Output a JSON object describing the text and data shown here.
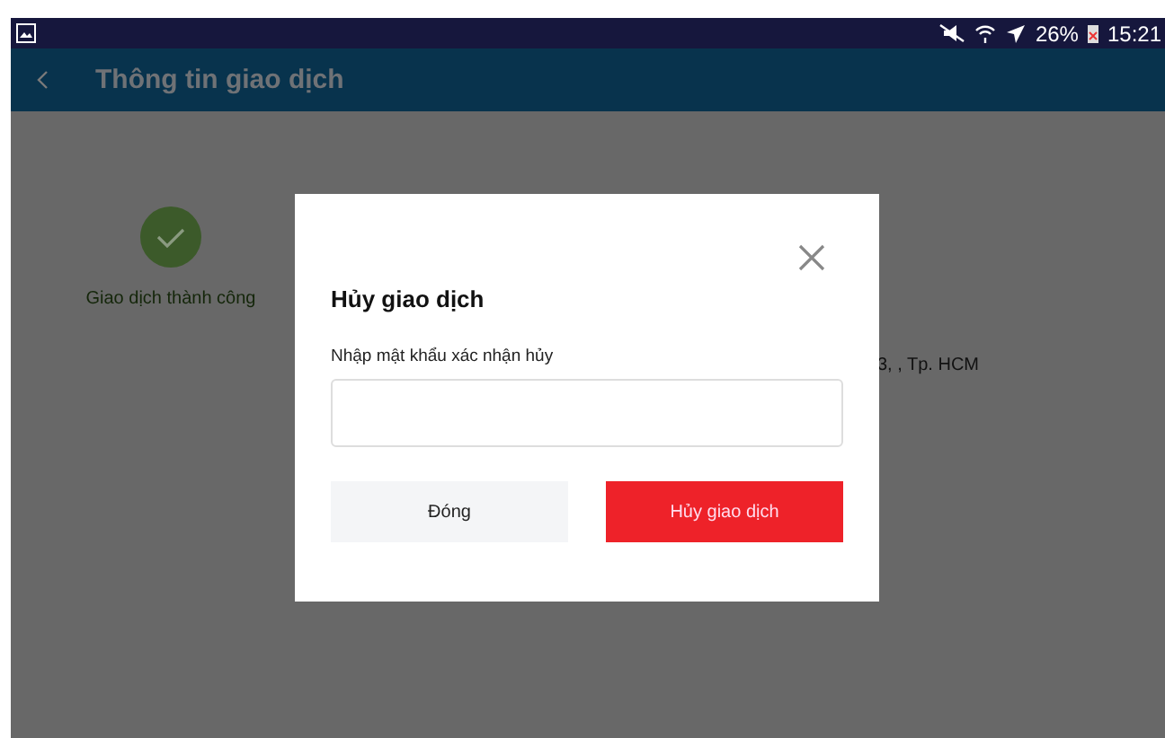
{
  "status_bar": {
    "battery": "26%",
    "time": "15:21"
  },
  "app_bar": {
    "title": "Thông tin giao dịch"
  },
  "background": {
    "status": "Giao dịch thành công",
    "address": "3, , Tp. HCM"
  },
  "dialog": {
    "title": "Hủy giao dịch",
    "field_label": "Nhập mật khẩu xác nhận hủy",
    "buttons": [
      {
        "label": "Đóng",
        "kind": "secondary"
      },
      {
        "label": "Hủy giao dịch",
        "kind": "primary"
      }
    ]
  }
}
